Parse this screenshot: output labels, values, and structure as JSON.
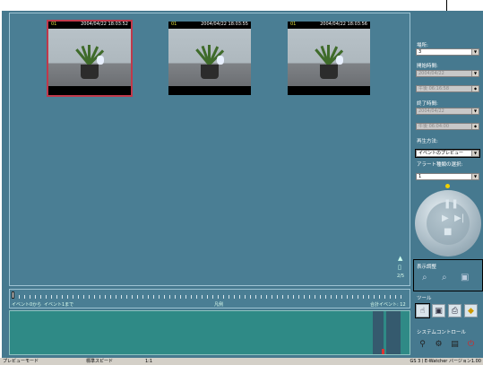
{
  "viewer": {
    "thumbnails": [
      {
        "camera": "01",
        "timestamp": "2004/04/22 18:03:52",
        "selected": true
      },
      {
        "camera": "01",
        "timestamp": "2004/04/22 18:03:55",
        "selected": false
      },
      {
        "camera": "01",
        "timestamp": "2004/04/22 18:03:56",
        "selected": false
      }
    ],
    "page_indicator": "2/5"
  },
  "panel": {
    "location_label": "場所:",
    "location_value": "3",
    "start_time_label": "開始時間:",
    "start_date": "2004/04/22",
    "start_clock": "午後 06:16:58",
    "end_time_label": "終了時間:",
    "end_date": "2004/04/22",
    "end_clock": "午後 06:04:00",
    "playback_label": "再生方法:",
    "playback_value": "イベントのプレビュー",
    "alert_label": "アラート種類の選択:",
    "alert_value": "1"
  },
  "display_adjust": {
    "label": "表示調整"
  },
  "tools": {
    "label": "ツール"
  },
  "system": {
    "label": "システムコントロール"
  },
  "timeline": {
    "left_text": "イベント0から",
    "left_text2": "イベント1まで",
    "center_text": "凡例",
    "right_text": "合計イベント: 12"
  },
  "status": {
    "mode": "プレビューモード",
    "speed": "標準スピード",
    "ratio": "1:1",
    "version": "GS 3ㅣE-Watcher バージョン1.00"
  },
  "colors": {
    "accent_selected": "#c0394b",
    "panel_bg": "#46798f"
  }
}
